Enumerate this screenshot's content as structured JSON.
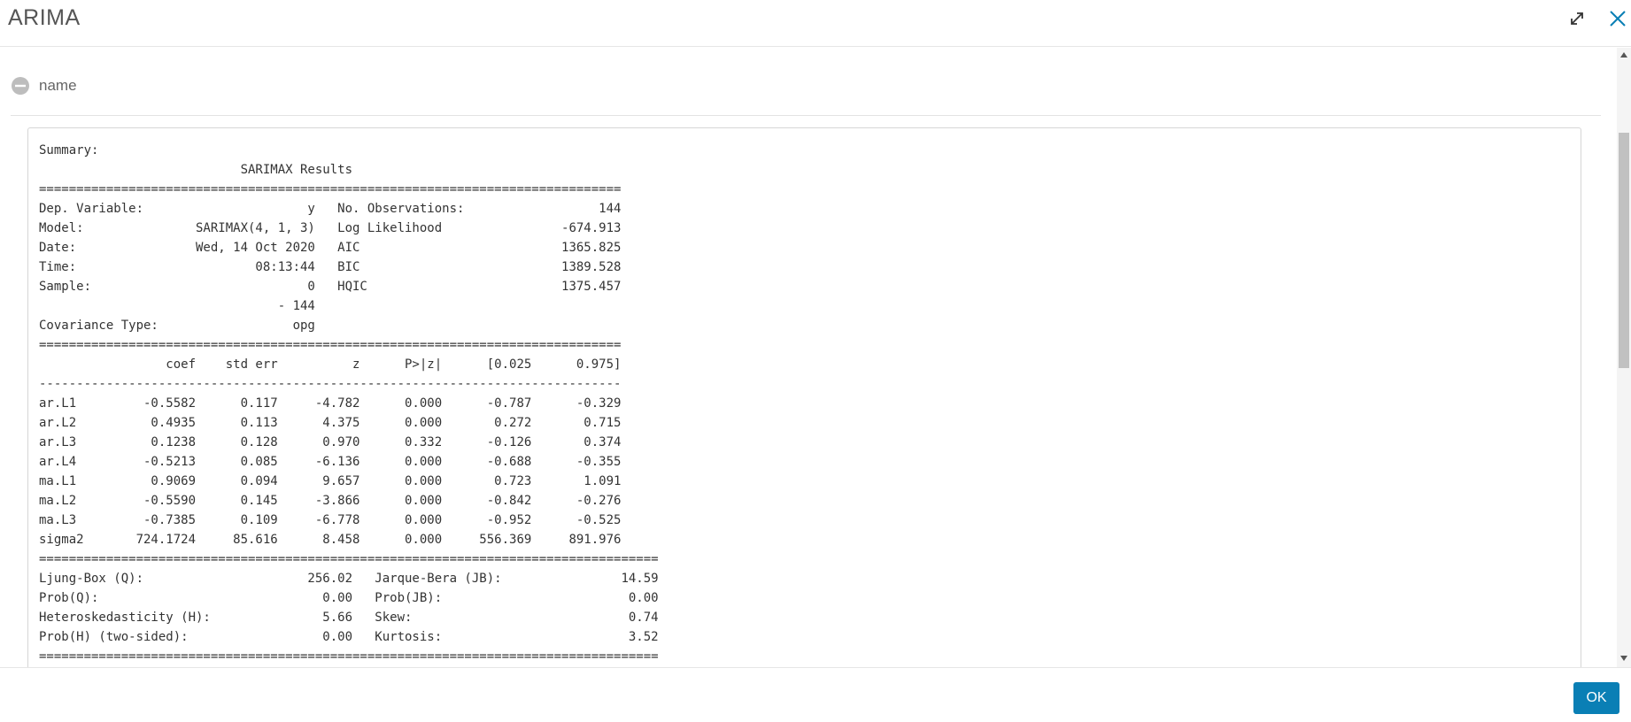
{
  "dialog": {
    "title": "ARIMA",
    "expand_icon": "expand-icon",
    "close_icon": "close-icon",
    "accent_color": "#0a7fb5"
  },
  "section": {
    "label": "name",
    "collapse_icon": "minus-circle-icon"
  },
  "output": {
    "lines": [
      "Summary:",
      "                           SARIMAX Results",
      "==============================================================================",
      "Dep. Variable:                      y   No. Observations:                  144",
      "Model:               SARIMAX(4, 1, 3)   Log Likelihood                -674.913",
      "Date:                Wed, 14 Oct 2020   AIC                           1365.825",
      "Time:                        08:13:44   BIC                           1389.528",
      "Sample:                             0   HQIC                          1375.457",
      "                                - 144",
      "Covariance Type:                  opg",
      "==============================================================================",
      "                 coef    std err          z      P>|z|      [0.025      0.975]",
      "------------------------------------------------------------------------------",
      "ar.L1         -0.5582      0.117     -4.782      0.000      -0.787      -0.329",
      "ar.L2          0.4935      0.113      4.375      0.000       0.272       0.715",
      "ar.L3          0.1238      0.128      0.970      0.332      -0.126       0.374",
      "ar.L4         -0.5213      0.085     -6.136      0.000      -0.688      -0.355",
      "ma.L1          0.9069      0.094      9.657      0.000       0.723       1.091",
      "ma.L2         -0.5590      0.145     -3.866      0.000      -0.842      -0.276",
      "ma.L3         -0.7385      0.109     -6.778      0.000      -0.952      -0.525",
      "sigma2       724.1724     85.616      8.458      0.000     556.369     891.976",
      "===================================================================================",
      "Ljung-Box (Q):                      256.02   Jarque-Bera (JB):                14.59",
      "Prob(Q):                              0.00   Prob(JB):                         0.00",
      "Heteroskedasticity (H):               5.66   Skew:                             0.74",
      "Prob(H) (two-sided):                  0.00   Kurtosis:                         3.52",
      "==================================================================================="
    ]
  },
  "footer": {
    "ok_label": "OK"
  }
}
